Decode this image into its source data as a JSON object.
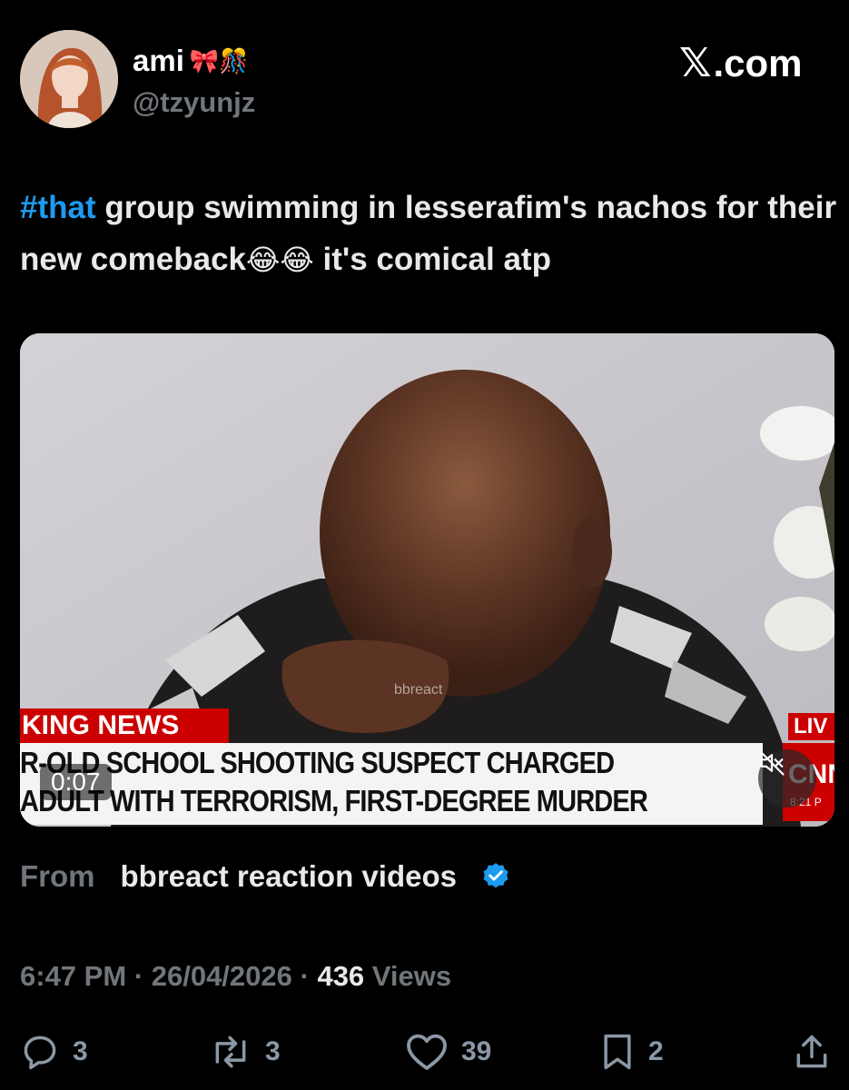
{
  "author": {
    "display_name": "ami",
    "name_emojis": "🎀🎊",
    "handle": "@tzyunjz",
    "avatar_icon": "avatar-photo"
  },
  "brand": {
    "label": ".com",
    "icon": "x-logo-icon"
  },
  "tweet": {
    "hashtag": "#that",
    "text_part1": " group swimming in lesserafim's nachos for their new comeback",
    "emojis": "😂😂",
    "text_part2": " it's comical atp"
  },
  "video": {
    "breaking_label": "KING NEWS",
    "headline_line1": "R-OLD SCHOOL SHOOTING SUSPECT CHARGED",
    "headline_line2": "ADULT WITH TERRORISM, FIRST-DEGREE MURDER",
    "live_label": "LIV",
    "network_label": "CNN",
    "clock_label": "8:21 P",
    "watermark": "bbreact",
    "timer": "0:07",
    "mute_icon": "speaker-muted-icon"
  },
  "source": {
    "from_label": "From",
    "name": "bbreact reaction videos",
    "verified_icon": "verified-badge-icon"
  },
  "meta": {
    "time": "6:47 PM",
    "separator": " · ",
    "date": "26/04/2026",
    "views_count": "436",
    "views_label": " Views"
  },
  "actions": {
    "replies": "3",
    "reposts": "3",
    "likes": "39",
    "bookmarks": "2"
  },
  "colors": {
    "background": "#000000",
    "text": "#e7e9ea",
    "muted": "#71767b",
    "link": "#1d9bf0",
    "news_red": "#cc0000"
  }
}
